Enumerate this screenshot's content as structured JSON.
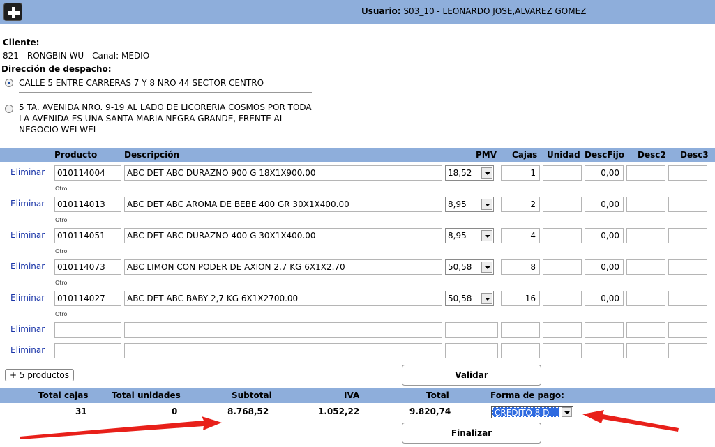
{
  "header": {
    "add_icon": "plus-icon",
    "user_label": "Usuario:",
    "user_value": "S03_10 - LEONARDO JOSE,ALVAREZ GOMEZ"
  },
  "client": {
    "label": "Cliente:",
    "value": "821 - RONGBIN WU - Canal: MEDIO"
  },
  "delivery": {
    "label": "Dirección de despacho:",
    "addresses": [
      {
        "text": "CALLE 5 ENTRE CARRERAS 7 Y 8 NRO 44 SECTOR CENTRO",
        "selected": true
      },
      {
        "text": "5 TA. AVENIDA NRO. 9-19 AL LADO DE LICORERIA COSMOS POR TODA LA AVENIDA ES UNA SANTA MARIA NEGRA GRANDE, FRENTE AL NEGOCIO WEI WEI",
        "selected": false
      }
    ]
  },
  "table": {
    "headers": {
      "producto": "Producto",
      "descripcion": "Descripción",
      "pmv": "PMV",
      "cajas": "Cajas",
      "unidad": "Unidad",
      "descfijo": "DescFijo",
      "desc2": "Desc2",
      "desc3": "Desc3"
    },
    "delete_label": "Eliminar",
    "other_label": "Otro",
    "rows": [
      {
        "code": "010114004",
        "desc": "ABC DET ABC DURAZNO 900 G 18X1X900.00",
        "pmv": "18,52",
        "cajas": "1",
        "unidad": "",
        "descfijo": "0,00",
        "desc2": "",
        "desc3": ""
      },
      {
        "code": "010114013",
        "desc": "ABC DET ABC AROMA DE BEBE 400 GR 30X1X400.00",
        "pmv": "8,95",
        "cajas": "2",
        "unidad": "",
        "descfijo": "0,00",
        "desc2": "",
        "desc3": ""
      },
      {
        "code": "010114051",
        "desc": "ABC DET ABC DURAZNO 400 G 30X1X400.00",
        "pmv": "8,95",
        "cajas": "4",
        "unidad": "",
        "descfijo": "0,00",
        "desc2": "",
        "desc3": ""
      },
      {
        "code": "010114073",
        "desc": "ABC LIMON CON PODER DE AXION 2.7 KG 6X1X2.70",
        "pmv": "50,58",
        "cajas": "8",
        "unidad": "",
        "descfijo": "0,00",
        "desc2": "",
        "desc3": ""
      },
      {
        "code": "010114027",
        "desc": "ABC DET ABC BABY 2,7 KG 6X1X2700.00",
        "pmv": "50,58",
        "cajas": "16",
        "unidad": "",
        "descfijo": "0,00",
        "desc2": "",
        "desc3": ""
      }
    ],
    "empty_rows": 2
  },
  "actions": {
    "more_products": "+ 5 productos",
    "validate": "Validar",
    "finalize": "Finalizar"
  },
  "totals": {
    "headers": {
      "cajas": "Total cajas",
      "unidades": "Total unidades",
      "subtotal": "Subtotal",
      "iva": "IVA",
      "total": "Total",
      "pago": "Forma de pago:"
    },
    "cajas": "31",
    "unidades": "0",
    "subtotal": "8.768,52",
    "iva": "1.052,22",
    "total": "9.820,74",
    "pago": "CREDITO 8 D"
  },
  "colors": {
    "header_bg": "#8eaedb",
    "link": "#1a35a8",
    "highlight": "#2e6ae0",
    "annotation_arrow": "#e8201a"
  }
}
